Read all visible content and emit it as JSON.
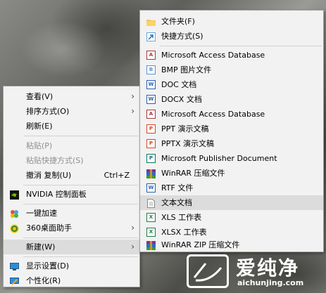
{
  "context_menu": {
    "items": [
      {
        "label": "查看(V)"
      },
      {
        "label": "排序方式(O)"
      },
      {
        "label": "刷新(E)"
      },
      {
        "label": "粘贴(P)"
      },
      {
        "label": "粘贴快捷方式(S)"
      },
      {
        "label": "撤消 复制(U)",
        "shortcut": "Ctrl+Z"
      },
      {
        "label": "NVIDIA 控制面板"
      },
      {
        "label": "一键加速"
      },
      {
        "label": "360桌面助手"
      },
      {
        "label": "新建(W)"
      },
      {
        "label": "显示设置(D)"
      },
      {
        "label": "个性化(R)"
      }
    ]
  },
  "new_submenu": {
    "items": [
      {
        "label": "文件夹(F)"
      },
      {
        "label": "快捷方式(S)"
      },
      {
        "label": "Microsoft Access Database"
      },
      {
        "label": "BMP 图片文件"
      },
      {
        "label": "DOC 文档"
      },
      {
        "label": "DOCX 文档"
      },
      {
        "label": "Microsoft Access Database"
      },
      {
        "label": "PPT 演示文稿"
      },
      {
        "label": "PPTX 演示文稿"
      },
      {
        "label": "Microsoft Publisher Document"
      },
      {
        "label": "WinRAR 压缩文件"
      },
      {
        "label": "RTF 文件"
      },
      {
        "label": "文本文档"
      },
      {
        "label": "XLS 工作表"
      },
      {
        "label": "XLSX 工作表"
      },
      {
        "label": "WinRAR ZIP 压缩文件"
      }
    ]
  },
  "watermark": {
    "brand": "爱纯净",
    "url": "aichunjing.com"
  }
}
